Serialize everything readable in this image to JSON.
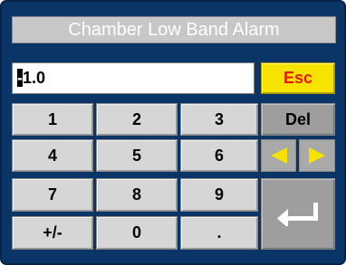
{
  "dialog": {
    "title": "Chamber Low Band Alarm",
    "input_cursor_char": "-",
    "input_rest": "1.0"
  },
  "keys": {
    "esc": "Esc",
    "del": "Del",
    "k1": "1",
    "k2": "2",
    "k3": "3",
    "k4": "4",
    "k5": "5",
    "k6": "6",
    "k7": "7",
    "k8": "8",
    "k9": "9",
    "plusminus": "+/-",
    "k0": "0",
    "dot": "."
  },
  "icons": {
    "left": "arrow-left-icon",
    "right": "arrow-right-icon",
    "enter": "enter-icon"
  },
  "colors": {
    "panel": "#0c3567",
    "esc_bg": "#f6e400",
    "esc_text": "#e8180c",
    "arrow": "#f6e400"
  }
}
